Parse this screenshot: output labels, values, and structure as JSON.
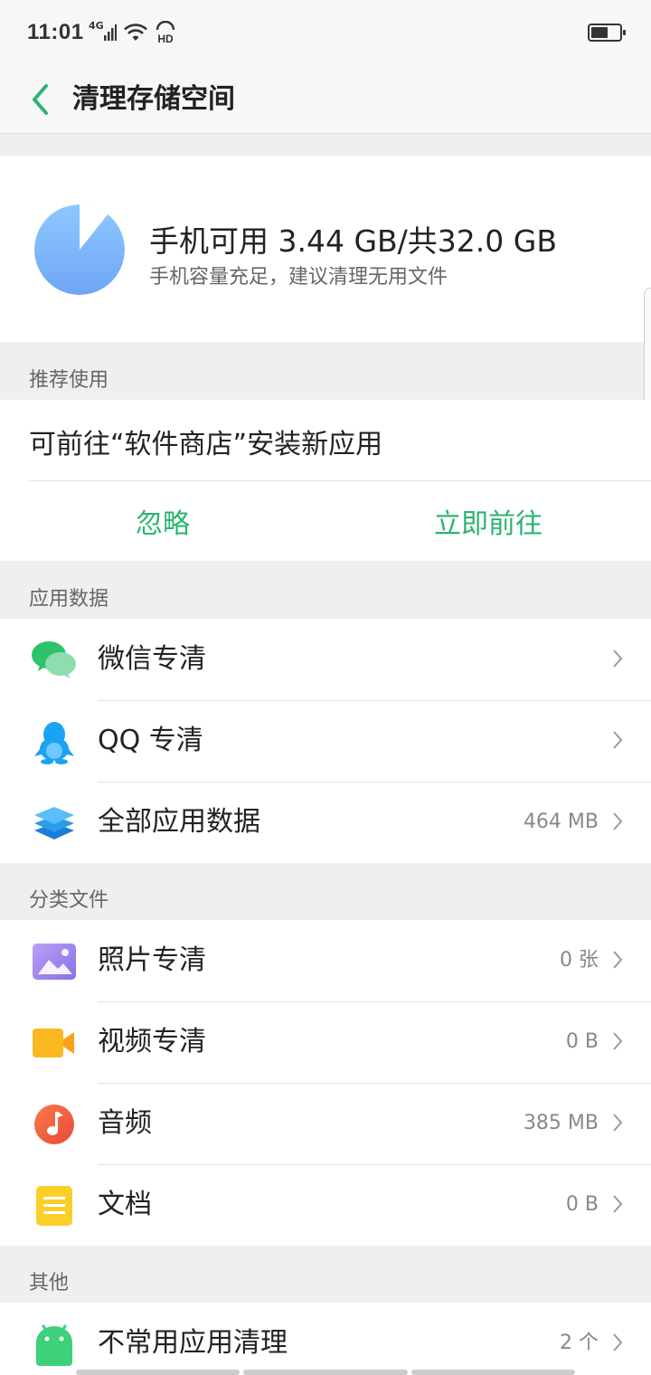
{
  "status_bar": {
    "time": "11:01",
    "network": "4G",
    "hd": "HD",
    "battery_level": 0.6
  },
  "app_bar": {
    "title": "清理存储空间",
    "back_icon": "chevron-left-icon",
    "accent_color": "#2bb472"
  },
  "storage": {
    "summary": "手机可用 3.44 GB/共32.0 GB",
    "hint": "手机容量充足，建议清理无用文件",
    "used_fraction": 0.8925,
    "pie_colors": [
      "#8fc8ff",
      "#6ea6f6"
    ]
  },
  "recommend": {
    "header": "推荐使用",
    "text": "可前往“软件商店”安装新应用",
    "ignore_label": "忽略",
    "go_label": "立即前往"
  },
  "app_data": {
    "header": "应用数据",
    "items": [
      {
        "label": "微信专清",
        "value": "",
        "icon": "wechat-icon"
      },
      {
        "label": "QQ 专清",
        "value": "",
        "icon": "qq-icon"
      },
      {
        "label": "全部应用数据",
        "value": "464 MB",
        "icon": "layers-icon"
      }
    ]
  },
  "files": {
    "header": "分类文件",
    "items": [
      {
        "label": "照片专清",
        "value": "0 张",
        "icon": "photo-icon"
      },
      {
        "label": "视频专清",
        "value": "0 B",
        "icon": "video-icon"
      },
      {
        "label": "音频",
        "value": "385 MB",
        "icon": "music-icon"
      },
      {
        "label": "文档",
        "value": "0 B",
        "icon": "document-icon"
      }
    ]
  },
  "other": {
    "header": "其他",
    "items": [
      {
        "label": "不常用应用清理",
        "value": "2 个",
        "icon": "android-icon"
      }
    ]
  }
}
